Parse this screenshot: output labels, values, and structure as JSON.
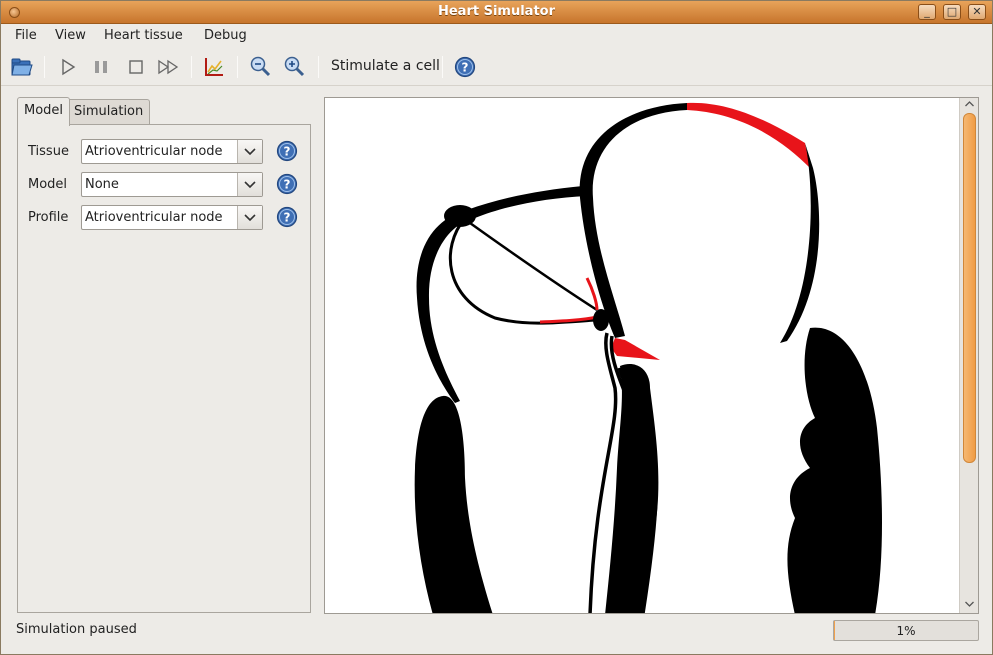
{
  "window": {
    "title": "Heart Simulator"
  },
  "menubar": {
    "items": [
      "File",
      "View",
      "Heart tissue",
      "Debug"
    ]
  },
  "toolbar": {
    "stimulate_label": "Stimulate a cell",
    "icons": [
      "open-folder",
      "play",
      "pause",
      "stop",
      "fast-forward",
      "chart",
      "zoom-out",
      "zoom-in",
      "help"
    ]
  },
  "tabs": [
    {
      "label": "Model",
      "active": true
    },
    {
      "label": "Simulation",
      "active": false
    }
  ],
  "fields": [
    {
      "label": "Tissue",
      "value": "Atrioventricular node"
    },
    {
      "label": "Model",
      "value": "None"
    },
    {
      "label": "Profile",
      "value": "Atrioventricular node"
    }
  ],
  "status": {
    "text": "Simulation paused"
  },
  "progress": {
    "value": 0.01,
    "label": "1%"
  },
  "colors": {
    "accent": "#e0892f",
    "tissue": "#000000",
    "stimulated": "#e8141a"
  }
}
